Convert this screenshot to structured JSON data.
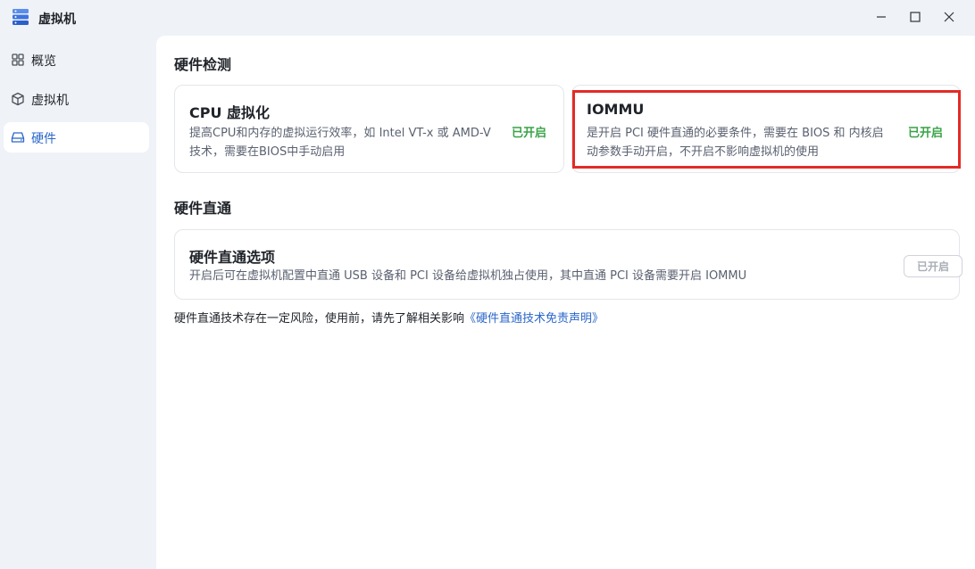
{
  "app": {
    "title": "虚拟机",
    "icon": "server-stack-icon"
  },
  "window_controls": [
    "minimize-icon",
    "maximize-icon",
    "close-icon"
  ],
  "sidebar": {
    "items": [
      {
        "label": "概览",
        "icon": "grid-icon",
        "active": false
      },
      {
        "label": "虚拟机",
        "icon": "cube-icon",
        "active": false
      },
      {
        "label": "硬件",
        "icon": "drive-icon",
        "active": true
      }
    ]
  },
  "hardware_detection": {
    "title": "硬件检测",
    "cards": [
      {
        "title": "CPU 虚拟化",
        "desc_line1": "提高CPU和内存的虚拟运行效率，如 Intel VT-x 或 AMD-V",
        "desc_line2": "技术，需要在BIOS中手动启用",
        "status": "已开启"
      },
      {
        "title": "IOMMU",
        "desc_line1": "是开启 PCI 硬件直通的必要条件，需要在 BIOS 和 内核启",
        "desc_line2": "动参数手动开启，不开启不影响虚拟机的使用",
        "status": "已开启"
      }
    ]
  },
  "passthrough": {
    "title": "硬件直通",
    "option_title": "硬件直通选项",
    "option_desc": "开启后可在虚拟机配置中直通 USB 设备和 PCI 设备给虚拟机独占使用，其中直通 PCI 设备需要开启 IOMMU",
    "button_label": "已开启"
  },
  "footnote": {
    "text": "硬件直通技术存在一定风险，使用前，请先了解相关影响",
    "link": "《硬件直通技术免责声明》"
  },
  "colors": {
    "accent": "#2b67c9",
    "success": "#3aa348",
    "highlight": "#e32b26",
    "sidebar_bg": "#eff2f7"
  }
}
